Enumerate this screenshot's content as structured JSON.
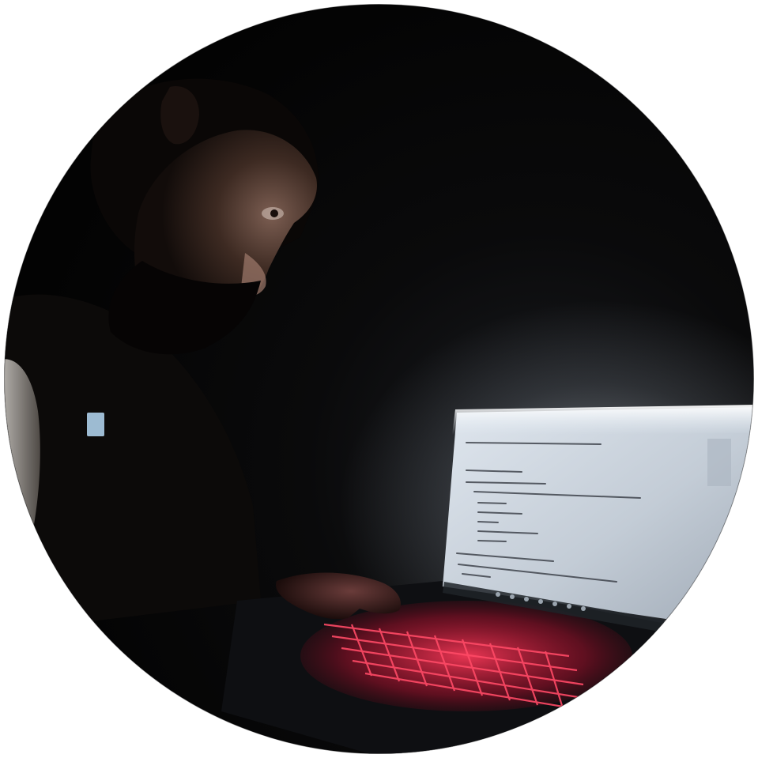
{
  "photo": {
    "subject": "",
    "colors": {
      "page_background": "#ffffff",
      "room_dark": "#050505",
      "skin_shadow": "#2a1c16",
      "skin_lit": "#8a6a5e",
      "screen_bg": "#c9d2dc",
      "screen_glow": "#f4f8fb",
      "code_text": "#2c3038",
      "keyboard_glow": "#ff2a4a",
      "laptop_body": "#0e0f12"
    }
  }
}
